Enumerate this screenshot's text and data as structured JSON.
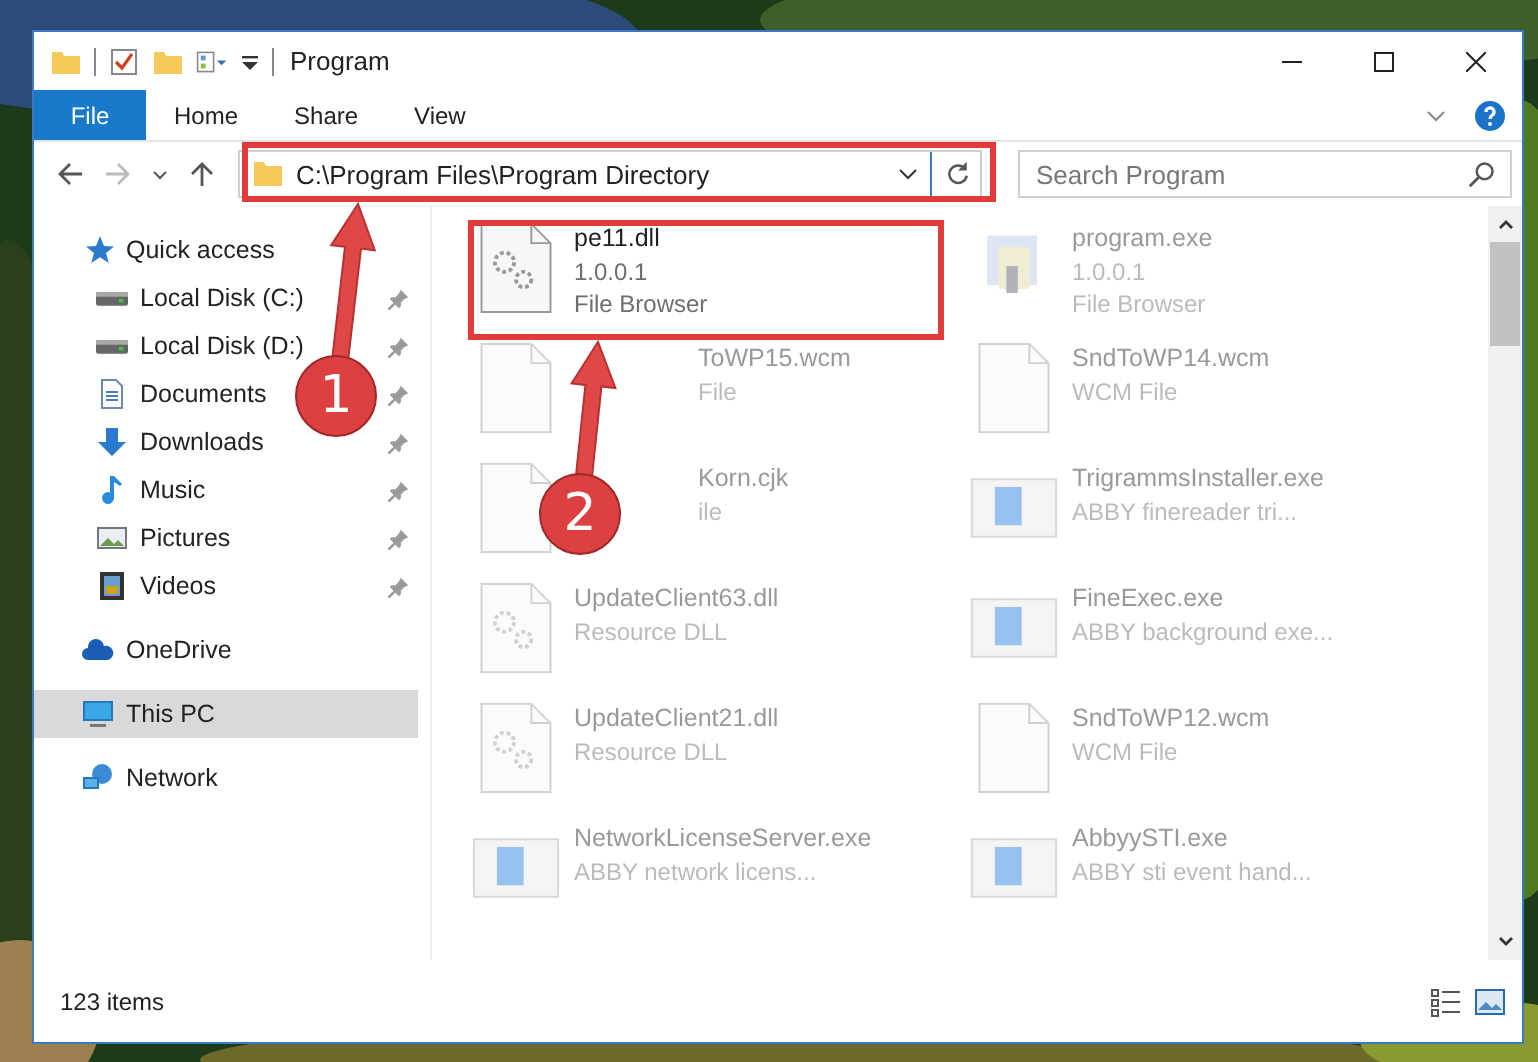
{
  "window": {
    "title": "Program"
  },
  "ribbon": {
    "tabs": [
      {
        "label": "File",
        "selected": true
      },
      {
        "label": "Home",
        "selected": false
      },
      {
        "label": "Share",
        "selected": false
      },
      {
        "label": "View",
        "selected": false
      }
    ]
  },
  "address_bar": {
    "path": "C:\\Program Files\\Program Directory"
  },
  "search": {
    "placeholder": "Search Program"
  },
  "sidebar": {
    "items": [
      {
        "label": "Quick access",
        "kind": "star",
        "selected": false,
        "children": [
          {
            "label": "Local Disk (C:)",
            "kind": "drive",
            "pinned": true,
            "selected": false
          },
          {
            "label": "Local Disk (D:)",
            "kind": "drive",
            "pinned": true,
            "selected": false
          },
          {
            "label": "Documents",
            "kind": "document",
            "pinned": true,
            "selected": false
          },
          {
            "label": "Downloads",
            "kind": "download",
            "pinned": true,
            "selected": false
          },
          {
            "label": "Music",
            "kind": "music",
            "pinned": true,
            "selected": false
          },
          {
            "label": "Pictures",
            "kind": "pictures",
            "pinned": true,
            "selected": false
          },
          {
            "label": "Videos",
            "kind": "video",
            "pinned": true,
            "selected": false
          }
        ]
      },
      {
        "label": "OneDrive",
        "kind": "cloud",
        "selected": false
      },
      {
        "label": "This PC",
        "kind": "pc",
        "selected": true
      },
      {
        "label": "Network",
        "kind": "network",
        "selected": false
      }
    ]
  },
  "files": [
    {
      "name": "pe11.dll",
      "details": [
        "1.0.0.1",
        "File Browser"
      ],
      "kind": "gears",
      "faded": false,
      "covered": false
    },
    {
      "name": "program.exe",
      "details": [
        "1.0.0.1",
        "File Browser"
      ],
      "kind": "setup",
      "faded": true,
      "covered": false
    },
    {
      "name": "ToWP15.wcm",
      "details": [
        "File"
      ],
      "kind": "blank",
      "faded": true,
      "covered": true
    },
    {
      "name": "SndToWP14.wcm",
      "details": [
        "WCM File"
      ],
      "kind": "blank",
      "faded": true,
      "covered": false
    },
    {
      "name": "Korn.cjk",
      "details": [
        "ile"
      ],
      "kind": "blank",
      "faded": true,
      "covered": true
    },
    {
      "name": "TrigrammsInstaller.exe",
      "details": [
        "ABBY finereader tri..."
      ],
      "kind": "app",
      "faded": true,
      "covered": false
    },
    {
      "name": "UpdateClient63.dll",
      "details": [
        "Resource DLL"
      ],
      "kind": "gears",
      "faded": true,
      "covered": false
    },
    {
      "name": "FineExec.exe",
      "details": [
        "ABBY background exe..."
      ],
      "kind": "app",
      "faded": true,
      "covered": false
    },
    {
      "name": "UpdateClient21.dll",
      "details": [
        "Resource DLL"
      ],
      "kind": "gears",
      "faded": true,
      "covered": false
    },
    {
      "name": "SndToWP12.wcm",
      "details": [
        "WCM File"
      ],
      "kind": "blank",
      "faded": true,
      "covered": false
    },
    {
      "name": "NetworkLicenseServer.exe",
      "details": [
        "ABBY network licens..."
      ],
      "kind": "app",
      "faded": true,
      "covered": false
    },
    {
      "name": "AbbyySTI.exe",
      "details": [
        "ABBY sti event hand..."
      ],
      "kind": "app",
      "faded": true,
      "covered": false
    }
  ],
  "status_bar": {
    "item_count": "123 items"
  },
  "callouts": [
    {
      "number": "1"
    },
    {
      "number": "2"
    }
  ]
}
